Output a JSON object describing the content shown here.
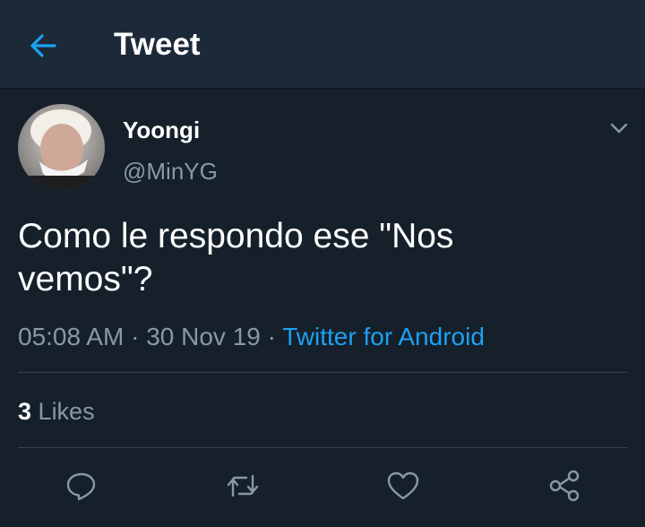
{
  "header": {
    "title": "Tweet",
    "back_icon": "arrow-left-icon"
  },
  "tweet": {
    "author_name": "Yoongi",
    "author_handle": "@MinYG",
    "text": "Como le respondo ese \"Nos vemos\"?",
    "time": "05:08 AM",
    "separator": "·",
    "date": "30 Nov 19",
    "source": "Twitter for Android",
    "likes_count": "3",
    "likes_label": "Likes"
  },
  "actions": [
    "reply-icon",
    "retweet-icon",
    "like-icon",
    "share-icon"
  ],
  "colors": {
    "background": "#15202b",
    "header_background": "#1c2938",
    "accent": "#1da1f2",
    "secondary_text": "#8899a6",
    "divider": "#38444d"
  }
}
